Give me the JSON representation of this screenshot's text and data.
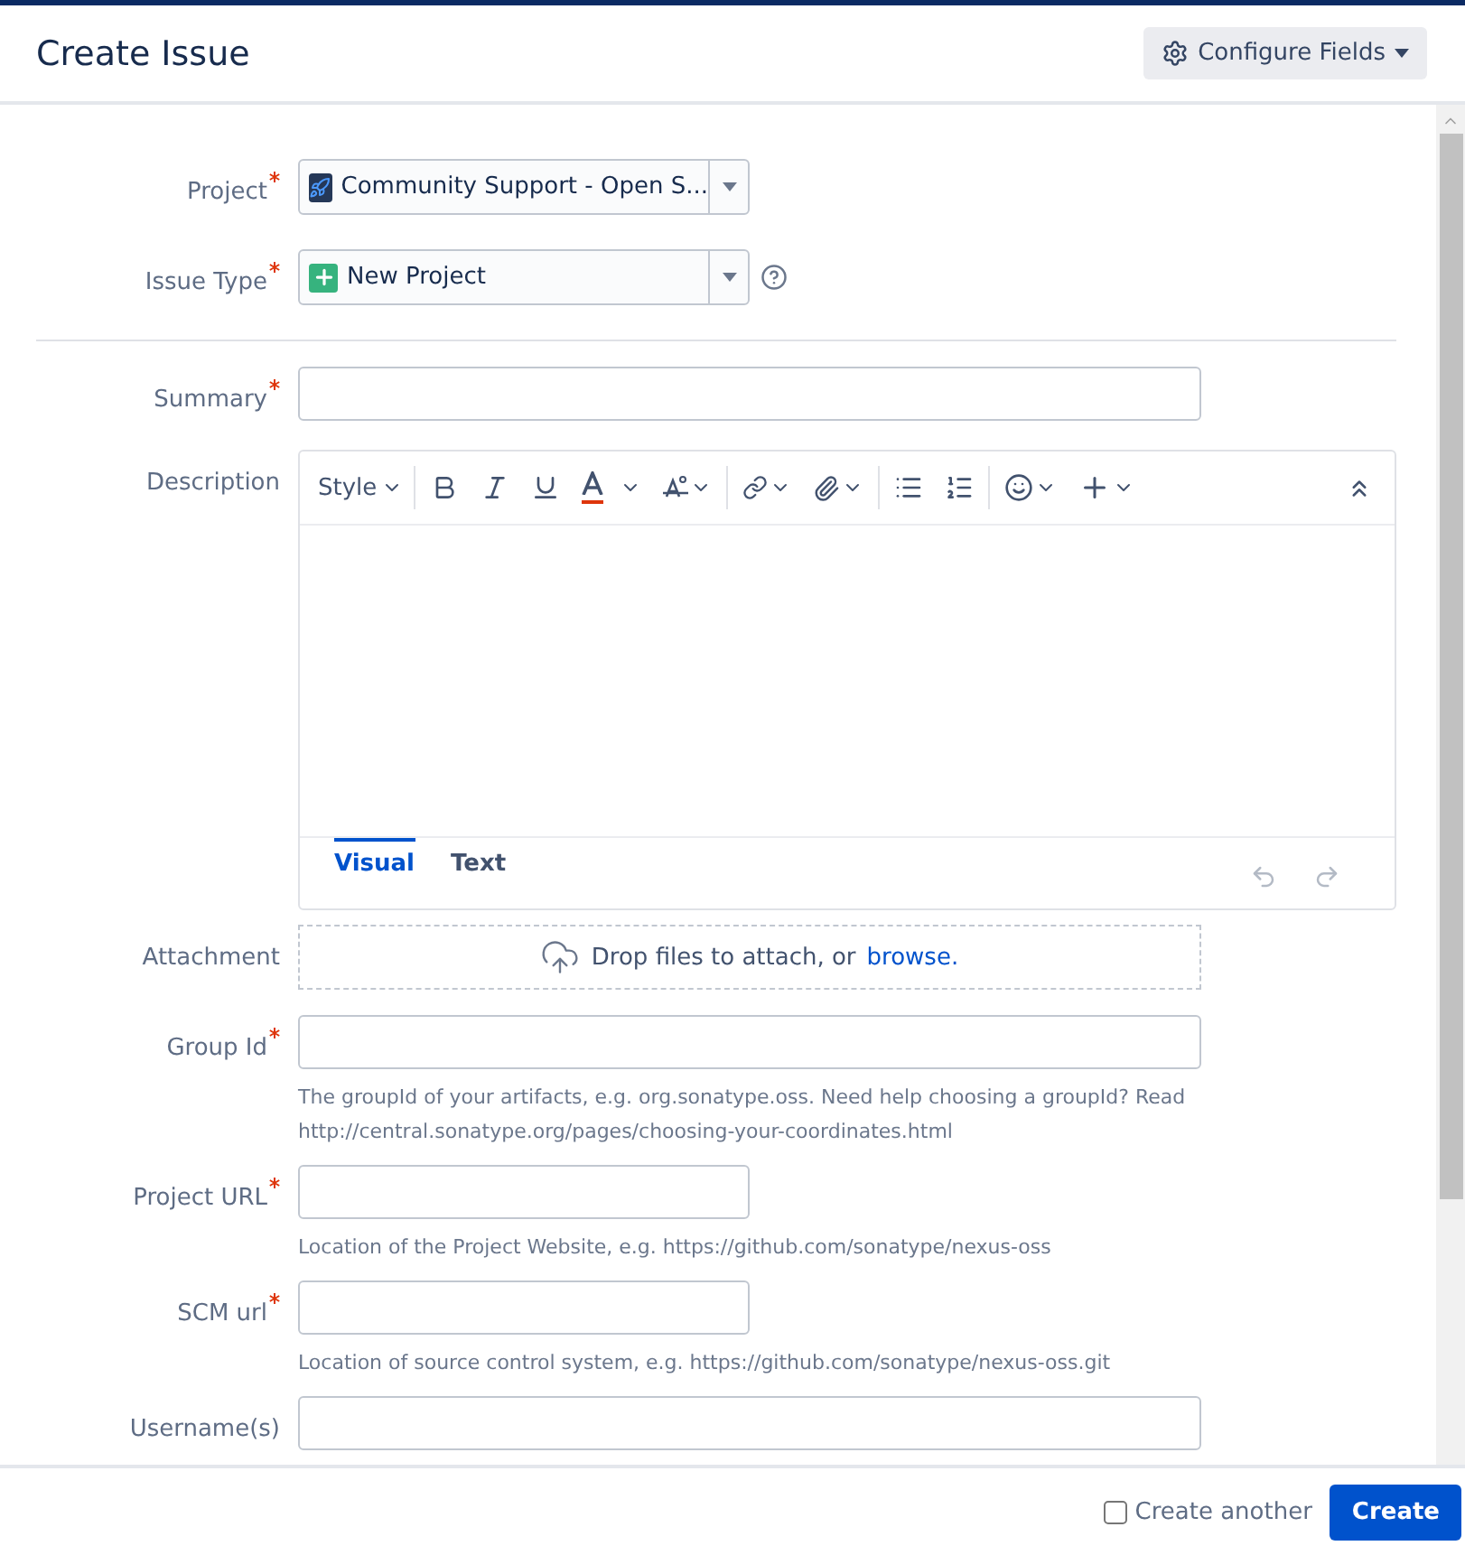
{
  "dialog": {
    "title": "Create Issue",
    "configure_button": "Configure Fields"
  },
  "top_fields": [
    {
      "kind": "select",
      "label": "Project",
      "required": true,
      "value": "Community Support - Open S...",
      "help": false
    },
    {
      "kind": "select",
      "label": "Issue Type",
      "required": true,
      "value": "New Project",
      "help": true
    }
  ],
  "fields": [
    {
      "kind": "text",
      "label": "Summary",
      "required": true,
      "wide": true
    },
    {
      "kind": "editor",
      "label": "Description",
      "required": false,
      "style_menu": "Style",
      "tabs": [
        {
          "label": "Visual",
          "selected": true
        },
        {
          "label": "Text",
          "selected": false
        }
      ]
    },
    {
      "kind": "attachment",
      "label": "Attachment",
      "required": false,
      "prompt": "Drop files to attach, or",
      "link": "browse."
    },
    {
      "kind": "text",
      "label": "Group Id",
      "required": true,
      "wide": true,
      "hint": [
        "The groupId of your artifacts, e.g. org.sonatype.oss. Need help choosing a groupId? Read",
        "http://central.sonatype.org/pages/choosing-your-coordinates.html"
      ]
    },
    {
      "kind": "text",
      "label": "Project URL",
      "required": true,
      "wide": false,
      "hint": [
        "Location of the Project Website, e.g. https://github.com/sonatype/nexus-oss"
      ]
    },
    {
      "kind": "text",
      "label": "SCM url",
      "required": true,
      "wide": false,
      "hint": [
        "Location of source control system, e.g. https://github.com/sonatype/nexus-oss.git"
      ]
    },
    {
      "kind": "text",
      "label": "Username(s)",
      "required": false,
      "wide": true
    }
  ],
  "footer": {
    "create_another": {
      "label": "Create another",
      "checked": false
    },
    "create_button": "Create"
  }
}
